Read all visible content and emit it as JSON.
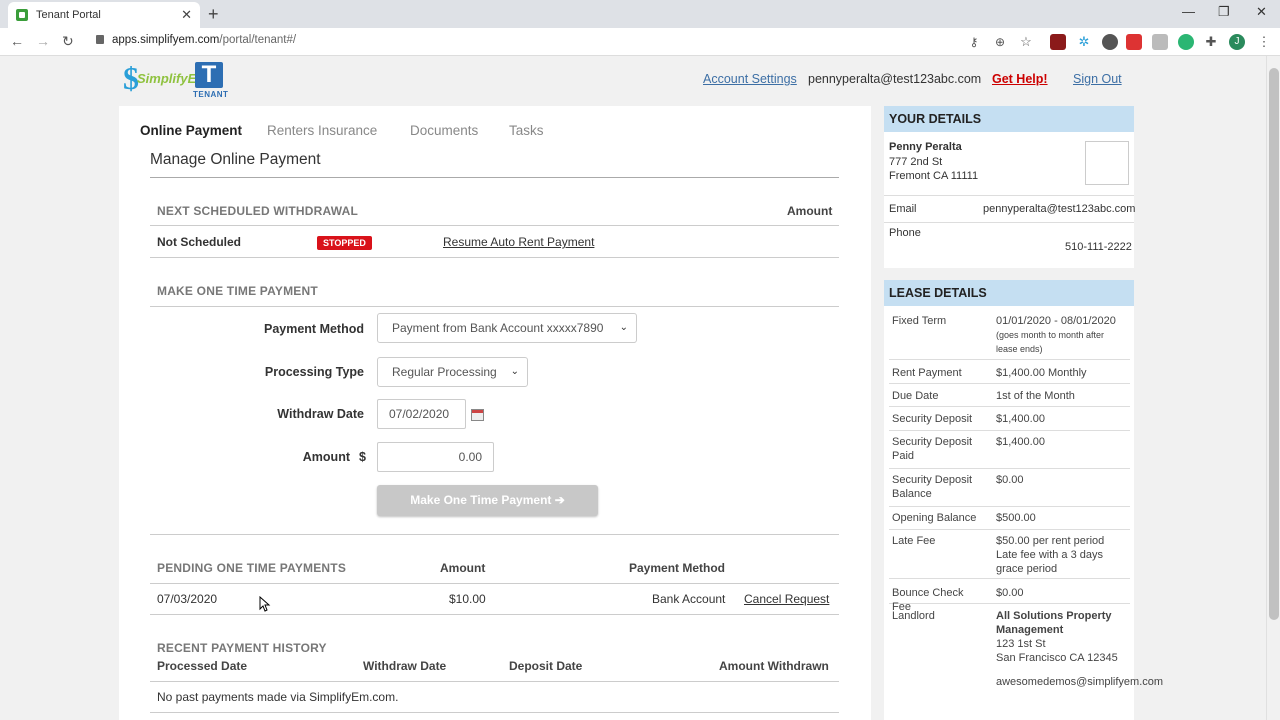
{
  "browser": {
    "tab_title": "Tenant Portal",
    "url_host": "apps.simplifyem.com",
    "url_path": "/portal/tenant#/",
    "profile_initial": "J"
  },
  "logo": {
    "brand": "SimplifyEm",
    "badge": "T",
    "sub": "TENANT"
  },
  "header": {
    "account_settings": "Account Settings",
    "email": "pennyperalta@test123abc.com",
    "get_help": "Get Help!",
    "sign_out": "Sign Out"
  },
  "tabs": [
    "Online Payment",
    "Renters Insurance",
    "Documents",
    "Tasks"
  ],
  "page_title": "Manage Online Payment",
  "withdrawal": {
    "section": "NEXT SCHEDULED WITHDRAWAL",
    "amount_header": "Amount",
    "status": "Not Scheduled",
    "badge": "STOPPED",
    "resume_link": "Resume Auto Rent Payment"
  },
  "one_time": {
    "section": "MAKE ONE TIME PAYMENT",
    "payment_method_label": "Payment Method",
    "payment_method_value": "Payment from Bank Account xxxxx7890",
    "processing_type_label": "Processing Type",
    "processing_type_value": "Regular Processing",
    "withdraw_date_label": "Withdraw Date",
    "withdraw_date_value": "07/02/2020",
    "amount_label": "Amount",
    "amount_currency": "$",
    "amount_value": "0.00",
    "submit": "Make One Time Payment ➔"
  },
  "pending": {
    "section": "PENDING ONE TIME PAYMENTS",
    "amount_header": "Amount",
    "method_header": "Payment Method",
    "date": "07/03/2020",
    "amount": "$10.00",
    "method": "Bank Account",
    "cancel": "Cancel Request"
  },
  "history": {
    "section": "RECENT PAYMENT HISTORY",
    "headers": [
      "Processed Date",
      "Withdraw Date",
      "Deposit Date",
      "Amount Withdrawn"
    ],
    "empty": "No past payments made via SimplifyEm.com."
  },
  "your_details": {
    "title": "YOUR DETAILS",
    "name": "Penny Peralta",
    "address1": "777 2nd St",
    "address2": "Fremont CA 11111",
    "email_label": "Email",
    "email": "pennyperalta@test123abc.com",
    "phone_label": "Phone",
    "phone": "510-111-2222"
  },
  "lease": {
    "title": "LEASE DETAILS",
    "rows": [
      {
        "k": "Fixed Term",
        "v": "01/01/2020 - 08/01/2020",
        "note": "(goes month to month after lease ends)"
      },
      {
        "k": "Rent Payment",
        "v": "$1,400.00 Monthly"
      },
      {
        "k": "Due Date",
        "v": "1st of the Month"
      },
      {
        "k": "Security Deposit",
        "v": "$1,400.00"
      },
      {
        "k": "Security Deposit Paid",
        "v": "$1,400.00"
      },
      {
        "k": "Security Deposit Balance",
        "v": "$0.00"
      },
      {
        "k": "Opening Balance",
        "v": "$500.00"
      },
      {
        "k": "Late Fee",
        "v": "$50.00 per rent period",
        "v2": "Late fee with a 3 days grace period"
      },
      {
        "k": "Bounce Check Fee",
        "v": "$0.00"
      },
      {
        "k": "Landlord",
        "v": "All Solutions Property Management",
        "v2": "123 1st St",
        "v3": "San Francisco CA 12345",
        "v4": "awesomedemos@simplifyem.com"
      }
    ]
  },
  "colors": {
    "link": "#3d6fa5",
    "danger": "#d9121a",
    "panel_header": "#c5dff2",
    "button_disabled": "#c8c8c8"
  }
}
